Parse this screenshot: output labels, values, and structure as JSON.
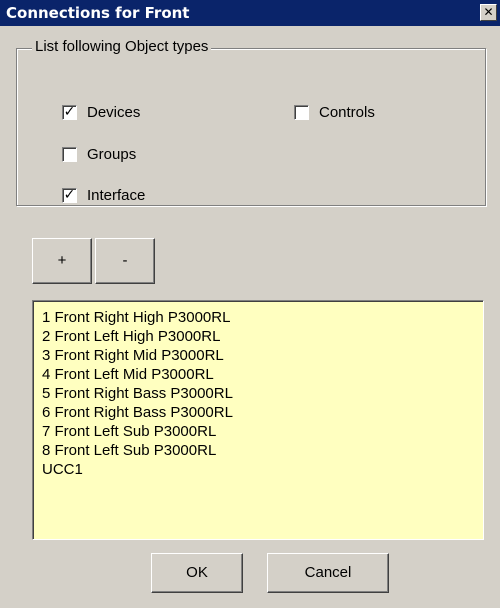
{
  "window": {
    "title": "Connections for Front",
    "close_glyph": "✕"
  },
  "group": {
    "label": "List following Object types"
  },
  "checkboxes": [
    {
      "label": "Devices",
      "checked": true
    },
    {
      "label": "Controls",
      "checked": false
    },
    {
      "label": "Groups",
      "checked": false
    },
    {
      "label": "Interface",
      "checked": true
    }
  ],
  "buttons": {
    "add": "+",
    "remove": "-",
    "ok": "OK",
    "cancel": "Cancel"
  },
  "list": {
    "items": [
      "1 Front Right High P3000RL",
      "2 Front Left High P3000RL",
      "3 Front Right Mid P3000RL",
      "4 Front Left Mid P3000RL",
      "5 Front Right Bass P3000RL",
      "6 Front Right Bass P3000RL",
      "7 Front Left Sub P3000RL",
      "8 Front Left Sub P3000RL",
      "UCC1"
    ],
    "background": "#ffffc0"
  },
  "colors": {
    "titlebar": "#0a246a",
    "dialog": "#d4d0c8"
  }
}
